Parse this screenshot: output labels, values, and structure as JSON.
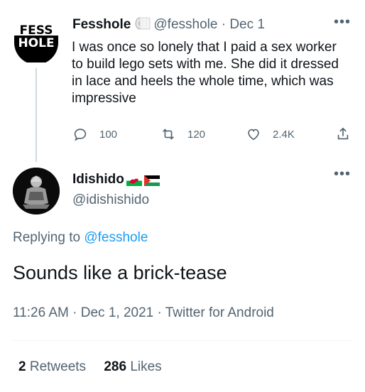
{
  "parent": {
    "logo_text_top": "FESS",
    "logo_text_bottom": "HOLE",
    "name": "Fesshole",
    "handle": "@fesshole",
    "sep": "·",
    "date": "Dec 1",
    "text": "I was once so lonely that I paid a sex worker to build lego sets with me. She did it dressed in lace and heels the whole time, which was impressive",
    "replies": "100",
    "retweets": "120",
    "likes": "2.4K"
  },
  "reply": {
    "name": "Idishido",
    "handle": "@idishishido",
    "replying_prefix": "Replying to",
    "replying_to": "@fesshole",
    "text": "Sounds like a brick-tease",
    "meta": "11:26 AM · Dec 1, 2021 · Twitter for Android",
    "retweet_count": "2",
    "retweet_label": "Retweets",
    "like_count": "286",
    "like_label": "Likes"
  },
  "icons": {
    "more": "more-dots-icon",
    "reply": "reply-icon",
    "retweet": "retweet-icon",
    "like": "heart-icon",
    "share": "share-icon",
    "toilet_paper": "toilet-paper-icon",
    "flags": [
      "wales-flag-icon",
      "palestine-flag-icon"
    ]
  },
  "colors": {
    "text": "#0f1419",
    "secondary": "#536471",
    "link": "#1d9bf0",
    "divider": "#eff3f4"
  }
}
